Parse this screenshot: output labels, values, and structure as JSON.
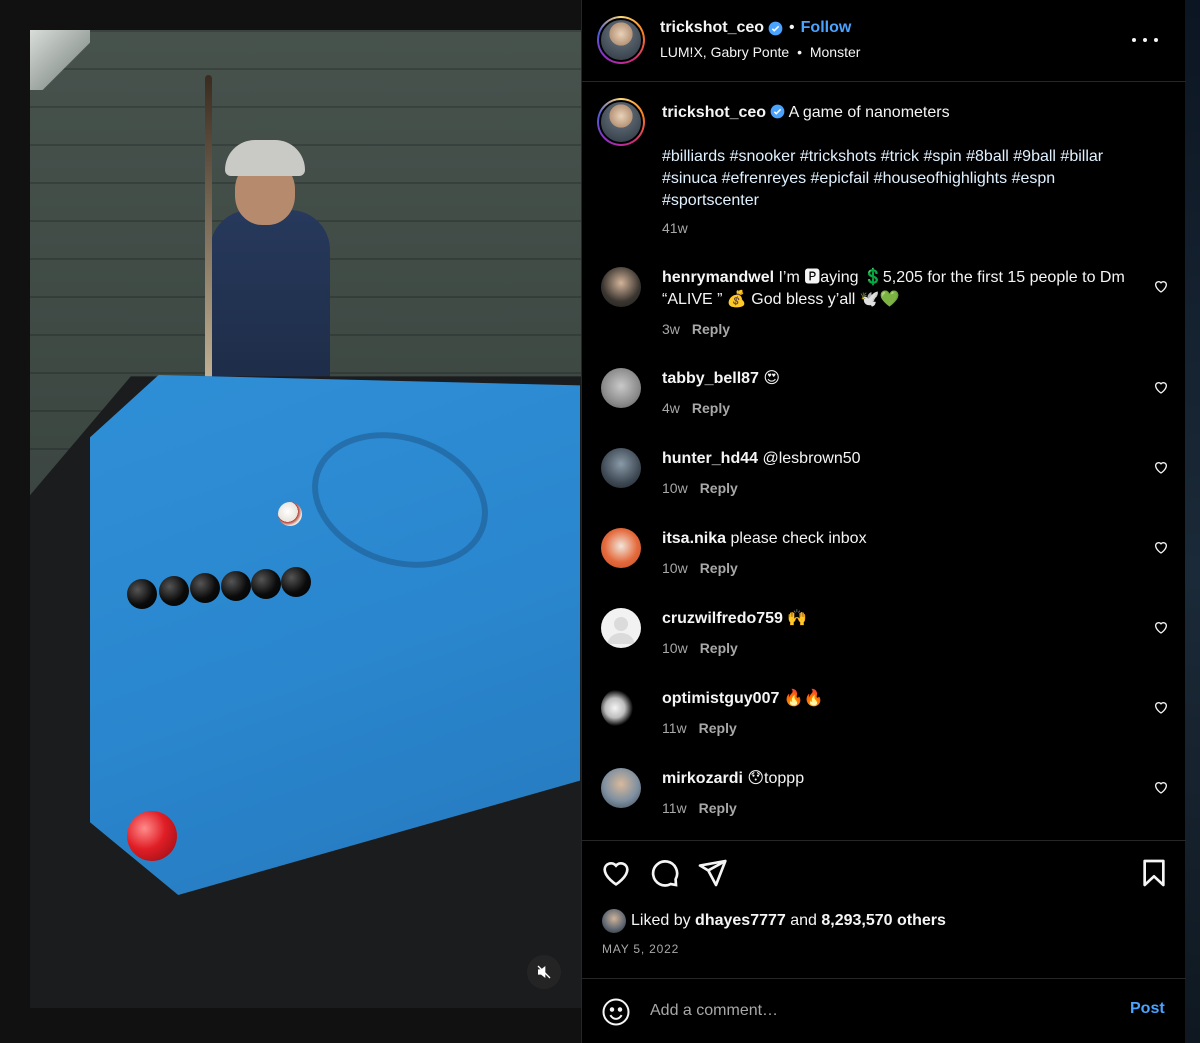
{
  "post": {
    "author": "trickshot_ceo",
    "follow_label": "Follow",
    "audio": "LUM!X, Gabry Ponte",
    "audio_sep": "•",
    "audio_track": "Monster",
    "caption": "A game of nanometers",
    "hashtags": "#billiards #snooker #trickshots #trick #spin #8ball #9ball #billar #sinuca #efrenreyes #epicfail #houseofhighlights #espn #sportscenter",
    "caption_age": "41w"
  },
  "comments": [
    {
      "user": "henrymandwel",
      "text": "I’m 🅿aying 💲5,205 for the first 15 people to Dm “ALIVE ” 💰 God bless y’all 🕊️💚",
      "age": "3w",
      "reply": "Reply"
    },
    {
      "user": "tabby_bell87",
      "text": "😍",
      "age": "4w",
      "reply": "Reply"
    },
    {
      "user": "hunter_hd44",
      "text": "@lesbrown50",
      "age": "10w",
      "reply": "Reply"
    },
    {
      "user": "itsa.nika",
      "text": "please check inbox",
      "age": "10w",
      "reply": "Reply"
    },
    {
      "user": "cruzwilfredo759",
      "text": "🙌",
      "age": "10w",
      "reply": "Reply"
    },
    {
      "user": "optimistguy007",
      "text": "🔥🔥",
      "age": "11w",
      "reply": "Reply"
    },
    {
      "user": "mirkozardi",
      "text": "😯toppp",
      "age": "11w",
      "reply": "Reply"
    }
  ],
  "likes": {
    "prefix": "Liked by",
    "user": "dhayes7777",
    "joiner": "and",
    "others": "8,293,570 others"
  },
  "date": "MAY 5, 2022",
  "comment_box": {
    "placeholder": "Add a comment…",
    "post_label": "Post"
  },
  "icons": {
    "header": [
      "verified-badge-icon",
      "more-options-icon"
    ],
    "actions": [
      "heart-icon",
      "comment-icon",
      "share-icon",
      "bookmark-icon"
    ],
    "media": [
      "muted-icon"
    ],
    "input": [
      "emoji-icon"
    ]
  },
  "colors": {
    "accent": "#4aa3ff",
    "background": "#000000",
    "secondary_text": "#a8a8a8",
    "felt": "#2a87cf"
  }
}
